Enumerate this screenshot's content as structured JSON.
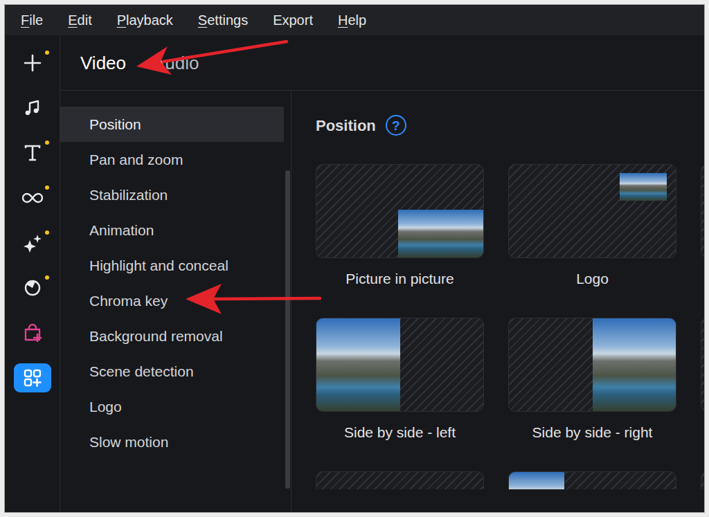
{
  "menu_bar": {
    "items": [
      {
        "label": "File",
        "underlined": true
      },
      {
        "label": "Edit",
        "underlined": true
      },
      {
        "label": "Playback",
        "underlined": true
      },
      {
        "label": "Settings",
        "underlined": true
      },
      {
        "label": "Export",
        "underlined": false
      },
      {
        "label": "Help",
        "underlined": true
      }
    ]
  },
  "toolbar": {
    "items": [
      {
        "dot": true,
        "selected": false
      },
      {
        "dot": false,
        "selected": false
      },
      {
        "dot": true,
        "selected": false
      },
      {
        "dot": true,
        "selected": false
      },
      {
        "dot": true,
        "selected": false
      },
      {
        "dot": true,
        "selected": false
      },
      {
        "dot": false,
        "selected": false
      },
      {
        "dot": false,
        "selected": true
      }
    ]
  },
  "tabs": [
    {
      "label": "Video",
      "selected": true
    },
    {
      "label": "Audio",
      "selected": false
    }
  ],
  "sections": {
    "items": [
      {
        "label": "Position",
        "selected": true
      },
      {
        "label": "Pan and zoom",
        "selected": false
      },
      {
        "label": "Stabilization",
        "selected": false
      },
      {
        "label": "Animation",
        "selected": false
      },
      {
        "label": "Highlight and conceal",
        "selected": false
      },
      {
        "label": "Chroma key",
        "selected": false
      },
      {
        "label": "Background removal",
        "selected": false
      },
      {
        "label": "Scene detection",
        "selected": false
      },
      {
        "label": "Logo",
        "selected": false
      },
      {
        "label": "Slow motion",
        "selected": false
      }
    ]
  },
  "panel": {
    "title": "Position",
    "help": "?"
  },
  "presets": [
    {
      "label": "Picture in picture",
      "kind": "pip"
    },
    {
      "label": "Logo",
      "kind": "logo"
    },
    {
      "kind": "blank"
    },
    {
      "label": "Side by side - left",
      "kind": "left"
    },
    {
      "label": "Side by side - right",
      "kind": "right"
    },
    {
      "kind": "blank"
    },
    {
      "kind": "blank"
    },
    {
      "kind": "top-left"
    },
    {
      "kind": "blank"
    }
  ]
}
